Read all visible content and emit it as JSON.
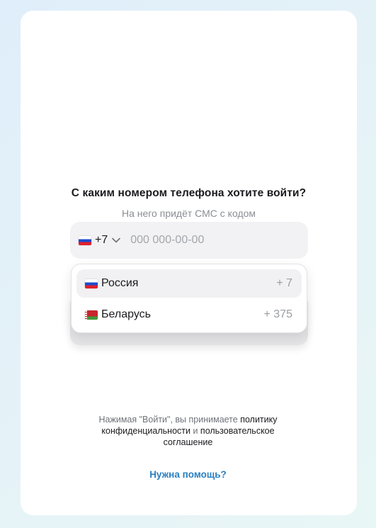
{
  "login": {
    "title": "С каким номером телефона хотите войти?",
    "subtitle": "На него придёт СМС с кодом",
    "country_code": "+7",
    "phone_placeholder": "000 000-00-00"
  },
  "dropdown": {
    "items": [
      {
        "name": "Россия",
        "code": "+ 7",
        "flag": "flag-russia-icon",
        "selected": true
      },
      {
        "name": "Беларусь",
        "code": "+ 375",
        "flag": "flag-belarus-icon",
        "selected": false
      }
    ]
  },
  "terms": {
    "prefix": "Нажимая \"Войти\", вы принимаете ",
    "privacy_link": "политику конфиденциальности",
    "and": " и ",
    "agreement_link": "пользовательское соглашение"
  },
  "help": {
    "label": "Нужна помощь?"
  },
  "colors": {
    "accent_link": "#2a7fc1",
    "field_bg": "#f2f2f4"
  }
}
